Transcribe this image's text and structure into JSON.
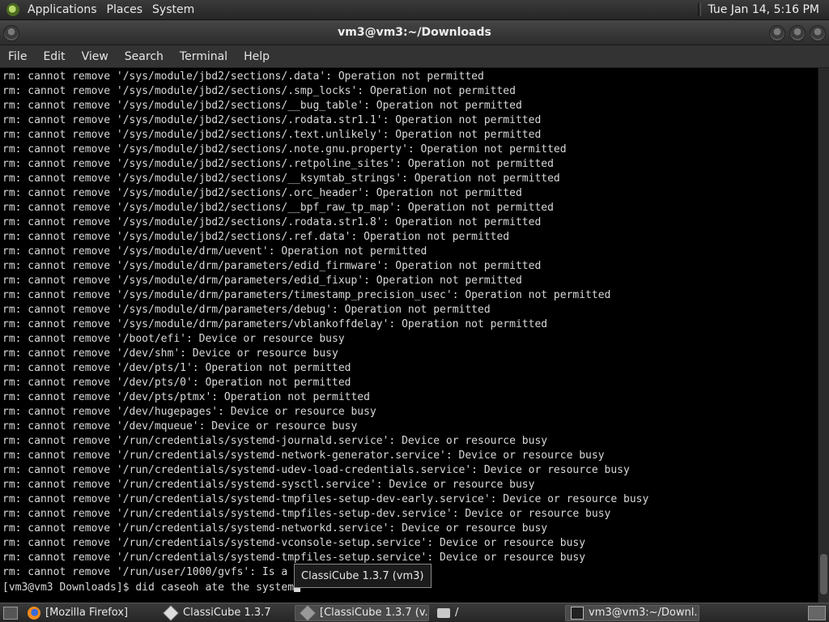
{
  "top_panel": {
    "menus": [
      "Applications",
      "Places",
      "System"
    ],
    "clock": "Tue Jan 14,  5:16 PM"
  },
  "window": {
    "title": "vm3@vm3:~/Downloads",
    "menu": [
      "File",
      "Edit",
      "View",
      "Search",
      "Terminal",
      "Help"
    ]
  },
  "terminal": {
    "lines": [
      "rm: cannot remove '/sys/module/jbd2/sections/.data': Operation not permitted",
      "rm: cannot remove '/sys/module/jbd2/sections/.smp_locks': Operation not permitted",
      "rm: cannot remove '/sys/module/jbd2/sections/__bug_table': Operation not permitted",
      "rm: cannot remove '/sys/module/jbd2/sections/.rodata.str1.1': Operation not permitted",
      "rm: cannot remove '/sys/module/jbd2/sections/.text.unlikely': Operation not permitted",
      "rm: cannot remove '/sys/module/jbd2/sections/.note.gnu.property': Operation not permitted",
      "rm: cannot remove '/sys/module/jbd2/sections/.retpoline_sites': Operation not permitted",
      "rm: cannot remove '/sys/module/jbd2/sections/__ksymtab_strings': Operation not permitted",
      "rm: cannot remove '/sys/module/jbd2/sections/.orc_header': Operation not permitted",
      "rm: cannot remove '/sys/module/jbd2/sections/__bpf_raw_tp_map': Operation not permitted",
      "rm: cannot remove '/sys/module/jbd2/sections/.rodata.str1.8': Operation not permitted",
      "rm: cannot remove '/sys/module/jbd2/sections/.ref.data': Operation not permitted",
      "rm: cannot remove '/sys/module/drm/uevent': Operation not permitted",
      "rm: cannot remove '/sys/module/drm/parameters/edid_firmware': Operation not permitted",
      "rm: cannot remove '/sys/module/drm/parameters/edid_fixup': Operation not permitted",
      "rm: cannot remove '/sys/module/drm/parameters/timestamp_precision_usec': Operation not permitted",
      "rm: cannot remove '/sys/module/drm/parameters/debug': Operation not permitted",
      "rm: cannot remove '/sys/module/drm/parameters/vblankoffdelay': Operation not permitted",
      "rm: cannot remove '/boot/efi': Device or resource busy",
      "rm: cannot remove '/dev/shm': Device or resource busy",
      "rm: cannot remove '/dev/pts/1': Operation not permitted",
      "rm: cannot remove '/dev/pts/0': Operation not permitted",
      "rm: cannot remove '/dev/pts/ptmx': Operation not permitted",
      "rm: cannot remove '/dev/hugepages': Device or resource busy",
      "rm: cannot remove '/dev/mqueue': Device or resource busy",
      "rm: cannot remove '/run/credentials/systemd-journald.service': Device or resource busy",
      "rm: cannot remove '/run/credentials/systemd-network-generator.service': Device or resource busy",
      "rm: cannot remove '/run/credentials/systemd-udev-load-credentials.service': Device or resource busy",
      "rm: cannot remove '/run/credentials/systemd-sysctl.service': Device or resource busy",
      "rm: cannot remove '/run/credentials/systemd-tmpfiles-setup-dev-early.service': Device or resource busy",
      "rm: cannot remove '/run/credentials/systemd-tmpfiles-setup-dev.service': Device or resource busy",
      "rm: cannot remove '/run/credentials/systemd-networkd.service': Device or resource busy",
      "rm: cannot remove '/run/credentials/systemd-vconsole-setup.service': Device or resource busy",
      "rm: cannot remove '/run/credentials/systemd-tmpfiles-setup.service': Device or resource busy",
      "rm: cannot remove '/run/user/1000/gvfs': Is a",
      "[vm3@vm3 Downloads]$ did caseoh ate the system"
    ]
  },
  "tooltip": "ClassiCube 1.3.7 (vm3)",
  "taskbar": {
    "tasks": [
      {
        "label": "[Mozilla Firefox]",
        "icon": "firefox-icon",
        "active": false
      },
      {
        "label": "ClassiCube 1.3.7",
        "icon": "classicube-icon",
        "active": false
      },
      {
        "label": "[ClassiCube 1.3.7 (v...",
        "icon": "classicube-icon",
        "active": true
      },
      {
        "label": "/",
        "icon": "folder-icon",
        "active": false
      },
      {
        "label": "vm3@vm3:~/Downl...",
        "icon": "terminal-icon",
        "active": true
      }
    ]
  }
}
